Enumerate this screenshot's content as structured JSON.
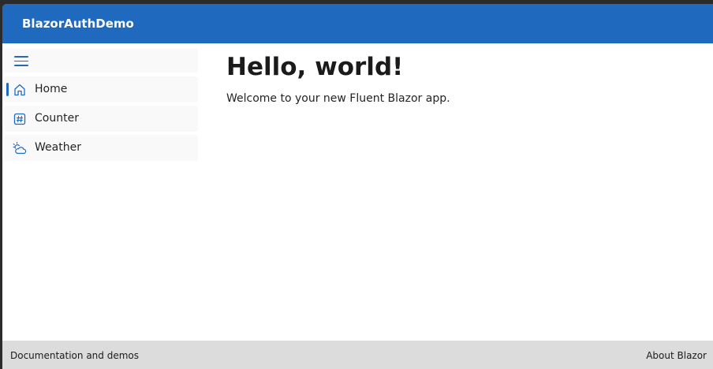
{
  "header": {
    "app_title": "BlazorAuthDemo"
  },
  "sidebar": {
    "items": [
      {
        "label": "Home",
        "icon": "home-icon",
        "active": true
      },
      {
        "label": "Counter",
        "icon": "number-symbol-icon",
        "active": false
      },
      {
        "label": "Weather",
        "icon": "weather-partly-cloudy-icon",
        "active": false
      }
    ]
  },
  "main": {
    "title": "Hello, world!",
    "welcome_text": "Welcome to your new Fluent Blazor app."
  },
  "footer": {
    "left_link": "Documentation and demos",
    "right_link": "About Blazor"
  },
  "colors": {
    "accent": "#1f6abf",
    "footer_bg": "#dcdcdc",
    "nav_bg": "#f9f9f9"
  }
}
